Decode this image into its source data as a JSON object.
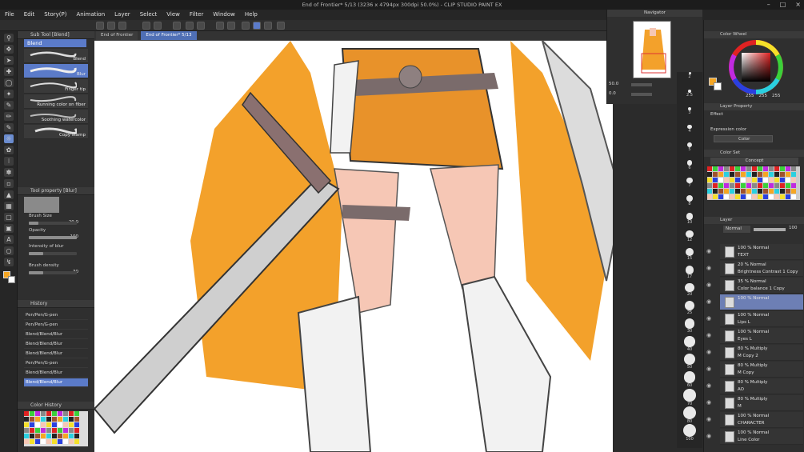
{
  "window": {
    "title": "End of Frontier* 5/13 (3236 x 4794px 300dpi 50.0%) - CLIP STUDIO PAINT EX"
  },
  "menu": [
    "File",
    "Edit",
    "Story(P)",
    "Animation",
    "Layer",
    "Select",
    "View",
    "Filter",
    "Window",
    "Help"
  ],
  "doc_tabs": [
    "End of Frontier",
    "End of Frontier* 5/13"
  ],
  "sub_tool": {
    "header": "Sub Tool [Blend]",
    "tab": "Blend",
    "brushes": [
      "Blend",
      "Blur",
      "Finger tip",
      "Running color on fiber",
      "Soothing watercolor",
      "Copy stamp"
    ],
    "selected_index": 1
  },
  "tool_property": {
    "header": "Tool property [Blur]",
    "rows": [
      {
        "label": "Brush Size",
        "value": "20.0",
        "level": 0.2
      },
      {
        "label": "Opacity",
        "value": "100",
        "level": 1.0
      },
      {
        "label": "Intensity of blur",
        "value": "",
        "level": 0.3
      },
      {
        "label": "Brush density",
        "value": "30",
        "level": 0.3
      }
    ]
  },
  "history": {
    "header": "History",
    "items": [
      "Pen/Pen/G-pen",
      "Pen/Pen/G-pen",
      "Blend/Blend/Blur",
      "Blend/Blend/Blur",
      "Blend/Blend/Blur",
      "Pen/Pen/G-pen",
      "Blend/Blend/Blur",
      "Blend/Blend/Blur"
    ],
    "selected_index": 7
  },
  "color_history": {
    "header": "Color History"
  },
  "navigator": {
    "header": "Navigator",
    "zoom": "50.0",
    "angle": "0.0"
  },
  "color_wheel": {
    "header": "Color Wheel",
    "rgb": [
      "255",
      "255",
      "255"
    ]
  },
  "layer_property": {
    "header": "Layer Property",
    "effect_label": "Effect",
    "expression_label": "Expression color",
    "expression_value": "Color"
  },
  "color_set": {
    "header": "Color Set",
    "set_name": "Concept"
  },
  "layer_panel": {
    "header": "Layer",
    "blend_mode": "Normal",
    "opacity": "100",
    "layers": [
      {
        "mode": "100 % Normal",
        "name": "TEXT"
      },
      {
        "mode": "20 % Normal",
        "name": "Brightness Contrast 1 Copy"
      },
      {
        "mode": "35 % Normal",
        "name": "Color balance 1 Copy"
      },
      {
        "mode": "100 % Normal",
        "name": ""
      },
      {
        "mode": "100 % Normal",
        "name": "Lips L"
      },
      {
        "mode": "100 % Normal",
        "name": "Eyes L"
      },
      {
        "mode": "80 % Multiply",
        "name": "M Copy 2"
      },
      {
        "mode": "80 % Multiply",
        "name": "M Copy"
      },
      {
        "mode": "80 % Multiply",
        "name": "AO"
      },
      {
        "mode": "80 % Multiply",
        "name": "M"
      },
      {
        "mode": "100 % Normal",
        "name": "CHARACTER"
      },
      {
        "mode": "100 % Normal",
        "name": "Line Color"
      }
    ],
    "selected_index": 3
  },
  "brush_size_ruler": [
    "2",
    "2.5",
    "3",
    "4",
    "5",
    "6",
    "7",
    "8",
    "10",
    "12",
    "15",
    "17",
    "20",
    "25",
    "30",
    "40",
    "50",
    "60",
    "70",
    "80",
    "100"
  ],
  "colors": {
    "accent": "#5b7bc9",
    "main_color": "#f5a623",
    "sub_color": "#ffffff"
  }
}
